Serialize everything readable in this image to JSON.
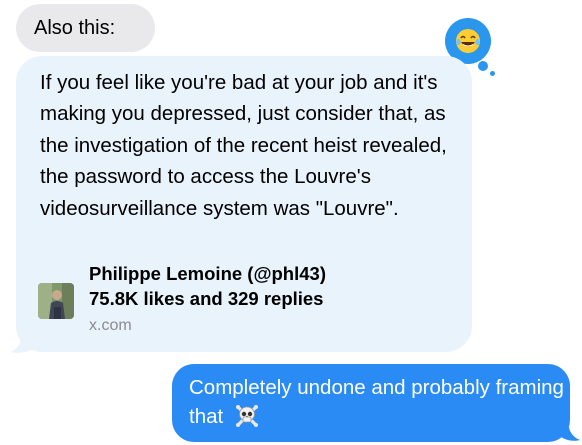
{
  "messages": {
    "intro": "Also this:",
    "reaction_icon": "laughing-tears-emoji",
    "shared_post": {
      "text": "If you feel like you're bad at your job and it's making you depressed, just consider that, as the investigation of the recent heist revealed, the password to access the Louvre's videosurveillance system was \"Louvre\".",
      "author": "Philippe Lemoine (@phl43)",
      "stats": "75.8K likes and 329 replies",
      "domain": "x.com"
    },
    "reply": {
      "text": "Completely undone and probably framing that",
      "emoji_icon": "skull-crossbones-emoji"
    }
  },
  "colors": {
    "incoming_bubble": "#e9e9eb",
    "link_bubble": "#e9f3fc",
    "outgoing_bubble": "#2b8bf4",
    "reaction_bg": "#2b96ee"
  }
}
